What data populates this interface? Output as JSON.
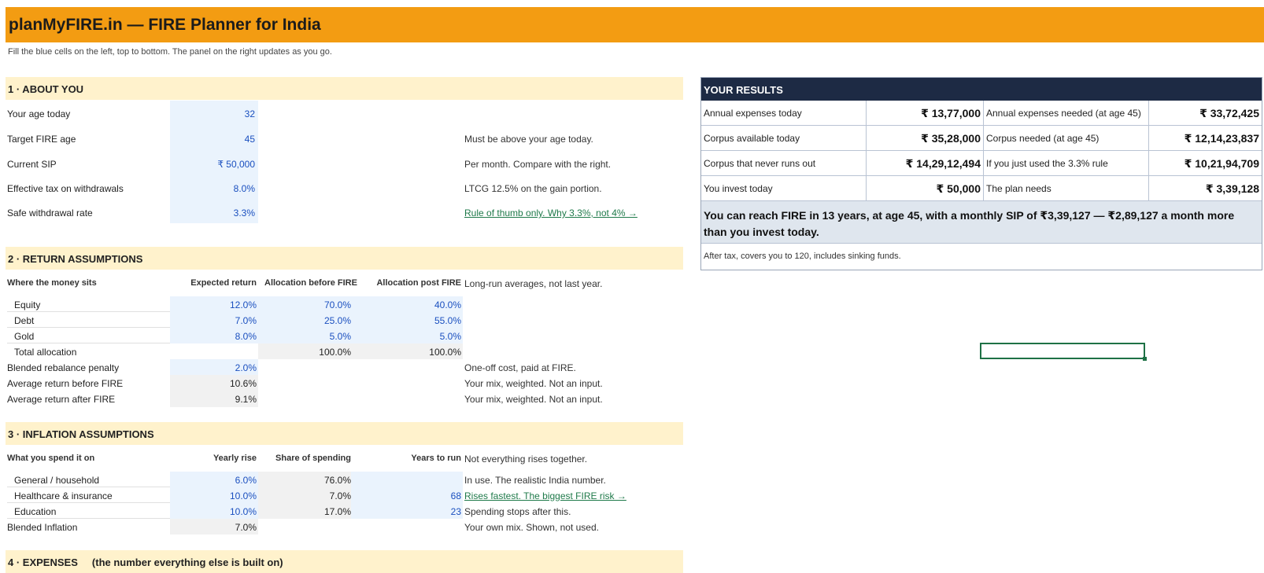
{
  "header": {
    "title": "planMyFIRE.in  —  FIRE Planner for India",
    "subtitle": "Fill the blue cells on the left, top to bottom. The panel on the right updates as you go."
  },
  "sections": {
    "about": {
      "heading": "1 · ABOUT YOU",
      "rows": [
        {
          "label": "Your age today",
          "value": "32",
          "note": ""
        },
        {
          "label": "Target FIRE age",
          "value": "45",
          "note": "Must be above your age today."
        },
        {
          "label": "Current SIP",
          "value": "₹ 50,000",
          "note": "Per month. Compare with the right."
        },
        {
          "label": "Effective tax on withdrawals",
          "value": "8.0%",
          "note": "LTCG 12.5% on the gain portion."
        },
        {
          "label": "Safe withdrawal rate",
          "value": "3.3%",
          "note": "Rule of thumb only. Why 3.3%, not 4% →"
        }
      ]
    },
    "returns": {
      "heading": "2 · RETURN ASSUMPTIONS",
      "col_headers": [
        "Where the money sits",
        "Expected return",
        "Allocation before FIRE",
        "Allocation post FIRE"
      ],
      "col_note": "Long-run averages, not last year.",
      "rows": [
        {
          "label": "Equity",
          "ret": "12.0%",
          "before": "70.0%",
          "after": "40.0%"
        },
        {
          "label": "Debt",
          "ret": "7.0%",
          "before": "25.0%",
          "after": "55.0%"
        },
        {
          "label": "Gold",
          "ret": "8.0%",
          "before": "5.0%",
          "after": "5.0%"
        }
      ],
      "total": {
        "label": "Total allocation",
        "before": "100.0%",
        "after": "100.0%"
      },
      "extra": [
        {
          "label": "Blended rebalance penalty",
          "value": "2.0%",
          "note": "One-off cost, paid at FIRE."
        },
        {
          "label": "Average return before FIRE",
          "value": "10.6%",
          "note": "Your mix, weighted. Not an input."
        },
        {
          "label": "Average return after FIRE",
          "value": "9.1%",
          "note": "Your mix, weighted. Not an input."
        }
      ]
    },
    "inflation": {
      "heading": "3 · INFLATION ASSUMPTIONS",
      "col_headers": [
        "What you spend it on",
        "Yearly rise",
        "Share of spending",
        "Years to run"
      ],
      "col_note": "Not everything rises together.",
      "rows": [
        {
          "label": "General / household",
          "rise": "6.0%",
          "share": "76.0%",
          "years": "",
          "note": "In use. The realistic India number."
        },
        {
          "label": "Healthcare & insurance",
          "rise": "10.0%",
          "share": "7.0%",
          "years": "68",
          "note": "Rises fastest. The biggest FIRE risk →"
        },
        {
          "label": "Education",
          "rise": "10.0%",
          "share": "17.0%",
          "years": "23",
          "note": "Spending stops after this."
        }
      ],
      "blended": {
        "label": "Blended Inflation",
        "value": "7.0%",
        "note": "Your own mix. Shown, not used."
      }
    },
    "expenses": {
      "heading": "4 · EXPENSES     (the number everything else is built on)"
    }
  },
  "results": {
    "heading": "YOUR RESULTS",
    "rows": [
      {
        "l1": "Annual expenses today",
        "v1": "₹ 13,77,000",
        "l2": "Annual expenses needed  (at age 45)",
        "v2": "₹ 33,72,425"
      },
      {
        "l1": "Corpus available today",
        "v1": "₹ 35,28,000",
        "l2": "Corpus needed  (at age 45)",
        "v2": "₹ 12,14,23,837"
      },
      {
        "l1": "Corpus that never runs out",
        "v1": "₹ 14,29,12,494",
        "l2": "If you just used the 3.3% rule",
        "v2": "₹ 10,21,94,709"
      },
      {
        "l1": "You invest today",
        "v1": "₹ 50,000",
        "l2": "The plan needs",
        "v2": "₹ 3,39,128"
      }
    ],
    "message": "You can reach FIRE in 13 years, at age 45, with a monthly SIP of ₹3,39,127 — ₹2,89,127 a month more than you invest today.",
    "footnote": "After tax, covers you to 120, includes sinking funds."
  },
  "colors": {
    "title_bar": "#f39c12",
    "section_header": "#fff2cc",
    "input_cell": "#eaf3fd",
    "results_header": "#1d2a44",
    "value_blue": "#1a4fbf",
    "link_green": "#1f7a4a"
  }
}
